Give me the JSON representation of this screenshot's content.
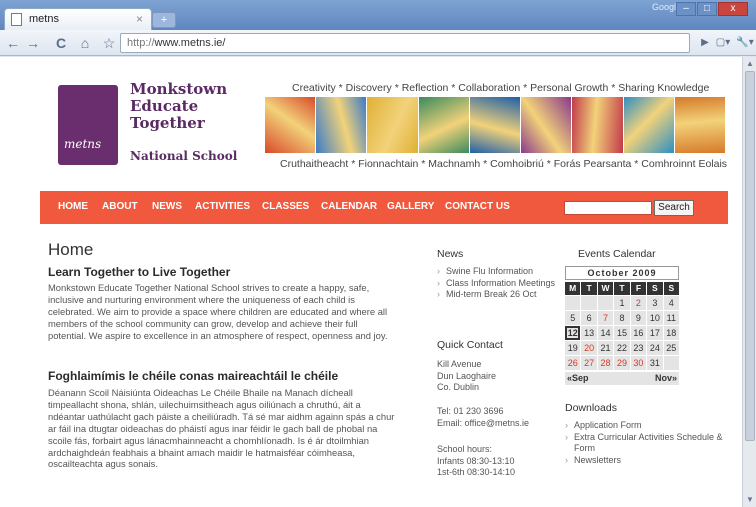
{
  "browser": {
    "tab_title": "metns",
    "tab_close": "×",
    "new_tab": "+",
    "google_label": "Google",
    "url_scheme": "http://",
    "url_rest": "www.metns.ie/",
    "back": "←",
    "forward": "→",
    "reload": "C",
    "home": "⌂",
    "star": "☆",
    "go": "▶",
    "page_menu": "▢▾",
    "tools_menu": "🔧▾",
    "minimize": "–",
    "maximize": "□",
    "close": "x"
  },
  "header": {
    "logo_line1": "Monkstown",
    "logo_line2": "Educate",
    "logo_line3": "Together",
    "logo_sub": "National School",
    "logo_initials": "metns",
    "tagline_top": "Creativity * Discovery * Reflection * Collaboration * Personal Growth * Sharing Knowledge",
    "tagline_bottom": "Cruthaitheacht * Fionnachtain * Machnamh * Comhoibriú * Forás Pearsanta * Comhroinnt Eolais",
    "banner_colors": [
      "#d84a2a",
      "#3b7bc9",
      "#e0b036",
      "#3a8a5d",
      "#1f5fa8",
      "#8a3a8c",
      "#c23a4a",
      "#2e8fc4",
      "#d67a2a"
    ]
  },
  "nav": {
    "items": [
      "HOME",
      "ABOUT",
      "NEWS",
      "ACTIVITIES",
      "CLASSES",
      "CALENDAR",
      "GALLERY",
      "CONTACT US"
    ],
    "search_value": "",
    "search_button": "Search"
  },
  "main": {
    "title": "Home",
    "heading1": "Learn Together to Live Together",
    "para1": "Monkstown Educate Together National School strives to create a happy, safe, inclusive and nurturing environment where the uniqueness of each child is celebrated. We aim to provide a space where children are educated and where all members of the school community can grow, develop and achieve their full potential. We aspire to excellence in an atmosphere of respect, openness and joy.",
    "heading2": "Foghlaimímis le chéile conas maireachtáil le chéile",
    "para2": "Déanann  Scoil Náisiúnta Oideachas Le Chéile Bhaile na Manach dícheall timpeallacht shona, shlán, uilechuimsitheach agus oiliúnach a chruthú, áit a ndéantar uathúlacht gach páiste a cheiliúradh. Tá sé mar aidhm againn spás a chur ar fáil ina dtugtar oideachas do pháistí agus inar féidir le gach ball de phobal na scoile fás, forbairt agus lánacmhainneacht a chomhlíonadh.  Is é ár dtoilmhian ardchaighdeán feabhais a bhaint amach maidir le hatmaisféar cóimheasa, oscailteachta agus sonais."
  },
  "news": {
    "title": "News",
    "items": [
      "Swine Flu Information",
      "Class Information Meetings",
      "Mid-term Break 26 Oct"
    ]
  },
  "contact": {
    "title": "Quick Contact",
    "address1": "Kill Avenue",
    "address2": "Dun Laoghaire",
    "address3": "Co. Dublin",
    "tel": "Tel: 01 230 3696",
    "email": "Email: office@metns.ie",
    "hours_label": "School hours:",
    "hours1": "Infants 08:30-13:10",
    "hours2": "1st-6th 08:30-14:10"
  },
  "calendar": {
    "title": "Events Calendar",
    "month": "October 2009",
    "days": [
      "M",
      "T",
      "W",
      "T",
      "F",
      "S",
      "S"
    ],
    "weeks": [
      [
        "",
        "",
        "",
        "1",
        "2",
        "3",
        "4"
      ],
      [
        "5",
        "6",
        "7",
        "8",
        "9",
        "10",
        "11"
      ],
      [
        "12",
        "13",
        "14",
        "15",
        "16",
        "17",
        "18"
      ],
      [
        "19",
        "20",
        "21",
        "22",
        "23",
        "24",
        "25"
      ],
      [
        "26",
        "27",
        "28",
        "29",
        "30",
        "31",
        ""
      ]
    ],
    "red_days": [
      "2",
      "7",
      "20",
      "26",
      "27",
      "28",
      "29",
      "30"
    ],
    "today": "12",
    "prev": "«Sep",
    "next": "Nov»"
  },
  "downloads": {
    "title": "Downloads",
    "items": [
      "Application Form",
      "Extra Curricular Activities Schedule & Form",
      "Newsletters"
    ]
  }
}
